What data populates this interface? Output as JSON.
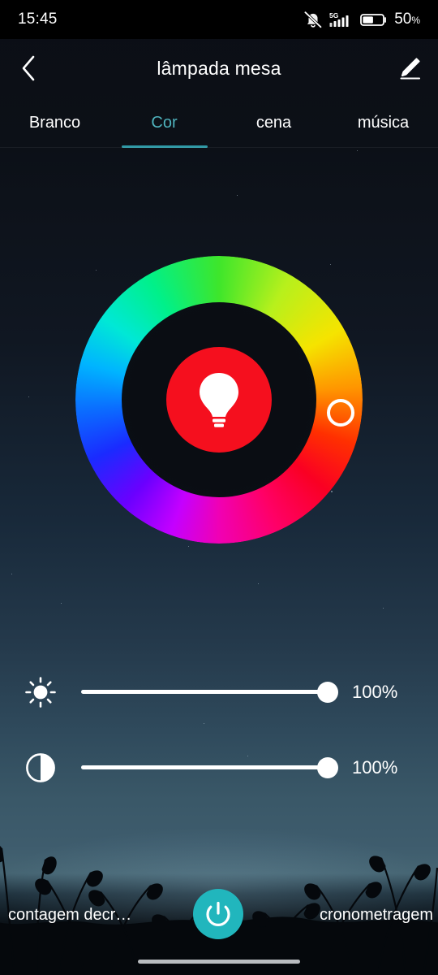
{
  "status_bar": {
    "time": "15:45",
    "network_label": "5G",
    "battery_percent": "50",
    "battery_percent_symbol": "%",
    "icons": [
      "bell-muted-icon",
      "signal-5g-icon",
      "battery-icon"
    ],
    "battery_fill_ratio": 0.5
  },
  "header": {
    "back_icon": "chevron-left-icon",
    "title": "lâmpada mesa",
    "edit_icon": "pencil-icon"
  },
  "tabs": [
    {
      "label": "Branco",
      "active": false
    },
    {
      "label": "Cor",
      "active": true
    },
    {
      "label": "cena",
      "active": false
    },
    {
      "label": "música",
      "active": false
    }
  ],
  "theme": {
    "accent_teal": "#21b6bd",
    "tab_active_text": "#4fb3bd",
    "tab_indicator": "#2e99a6",
    "selected_color": "#f50f1e",
    "text_primary": "#ffffff",
    "background_top": "#0b0e15",
    "background_bottom": "#456472"
  },
  "color_wheel": {
    "name": "color-wheel",
    "center_button_icon": "light-bulb-icon",
    "center_button_color": "#f50f1e",
    "handle_icon": "color-handle-icon",
    "handle_angle_deg": 108,
    "handle_color": "#fa0023"
  },
  "sliders": [
    {
      "name": "brightness",
      "icon": "brightness-sun-icon",
      "value": 100,
      "value_label": "100%"
    },
    {
      "name": "saturation",
      "icon": "contrast-half-circle-icon",
      "value": 100,
      "value_label": "100%"
    }
  ],
  "bottom_bar": {
    "left_label": "contagem decr…",
    "power_icon": "power-icon",
    "right_label": "cronometragem"
  }
}
